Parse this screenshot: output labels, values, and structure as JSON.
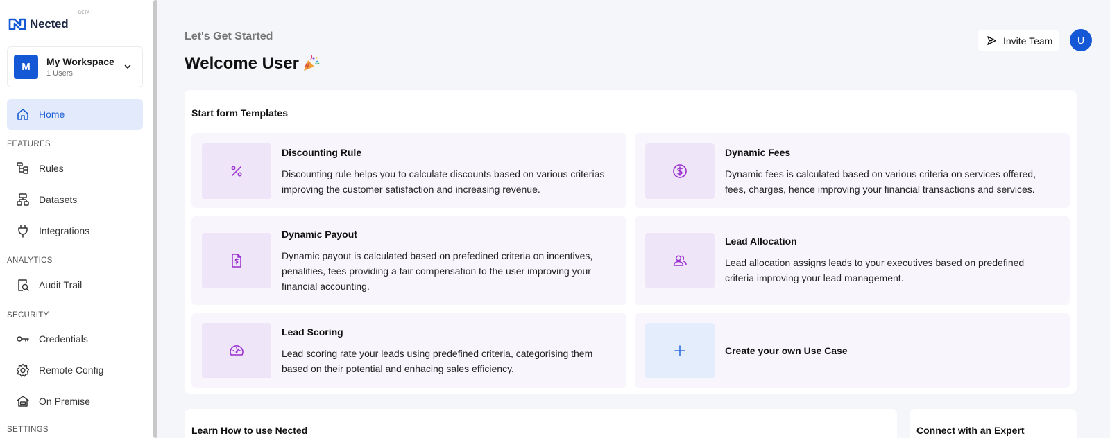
{
  "brand": {
    "name": "Nected",
    "badge": "BETA",
    "logo_color": "#1558d6"
  },
  "workspace": {
    "initial": "M",
    "name": "My Workspace",
    "users": "1 Users"
  },
  "sidebar": {
    "home": {
      "label": "Home",
      "icon": "home-icon"
    },
    "sections": {
      "features": "FEATURES",
      "analytics": "ANALYTICS",
      "security": "SECURITY",
      "settings": "SETTINGS"
    },
    "items": [
      {
        "label": "Rules",
        "icon": "rules-icon"
      },
      {
        "label": "Datasets",
        "icon": "datasets-icon"
      },
      {
        "label": "Integrations",
        "icon": "plug-icon"
      },
      {
        "label": "Audit Trail",
        "icon": "audit-icon"
      },
      {
        "label": "Credentials",
        "icon": "key-icon"
      },
      {
        "label": "Remote Config",
        "icon": "gear-icon"
      },
      {
        "label": "On Premise",
        "icon": "premise-icon"
      }
    ]
  },
  "header": {
    "subtitle": "Let's Get Started",
    "title": "Welcome User",
    "invite_label": "Invite Team",
    "user_initial": "U"
  },
  "templates": {
    "title": "Start form Templates",
    "cards": [
      {
        "title": "Discounting Rule",
        "description": "Discounting rule helps you to calculate discounts based on various criterias improving the customer satisfaction and increasing revenue.",
        "icon": "percent-icon"
      },
      {
        "title": "Dynamic Fees",
        "description": "Dynamic fees is calculated based on various criteria on services offered, fees, charges, hence improving your financial transactions and services.",
        "icon": "dollar-circle-icon"
      },
      {
        "title": "Dynamic Payout",
        "description": "Dynamic payout is calculated based on prefedined criteria on incentives, penalities, fees providing a fair compensation to the user improving your financial accounting.",
        "icon": "invoice-icon"
      },
      {
        "title": "Lead Allocation",
        "description": "Lead allocation assigns leads to your executives based on predefined criteria improving your lead management.",
        "icon": "users-icon"
      },
      {
        "title": "Lead Scoring",
        "description": "Lead scoring rate your leads using predefined criteria, categorising them based on their potential and enhacing sales efficiency.",
        "icon": "gauge-icon"
      },
      {
        "title": "Create your own Use Case",
        "icon": "plus-icon"
      }
    ]
  },
  "learn": {
    "title": "Learn How to use Nected"
  },
  "expert": {
    "title": "Connect with an Expert"
  },
  "colors": {
    "accent": "#1558d6",
    "active_bg": "#e2eafc",
    "purple": "#9b2fd1"
  }
}
